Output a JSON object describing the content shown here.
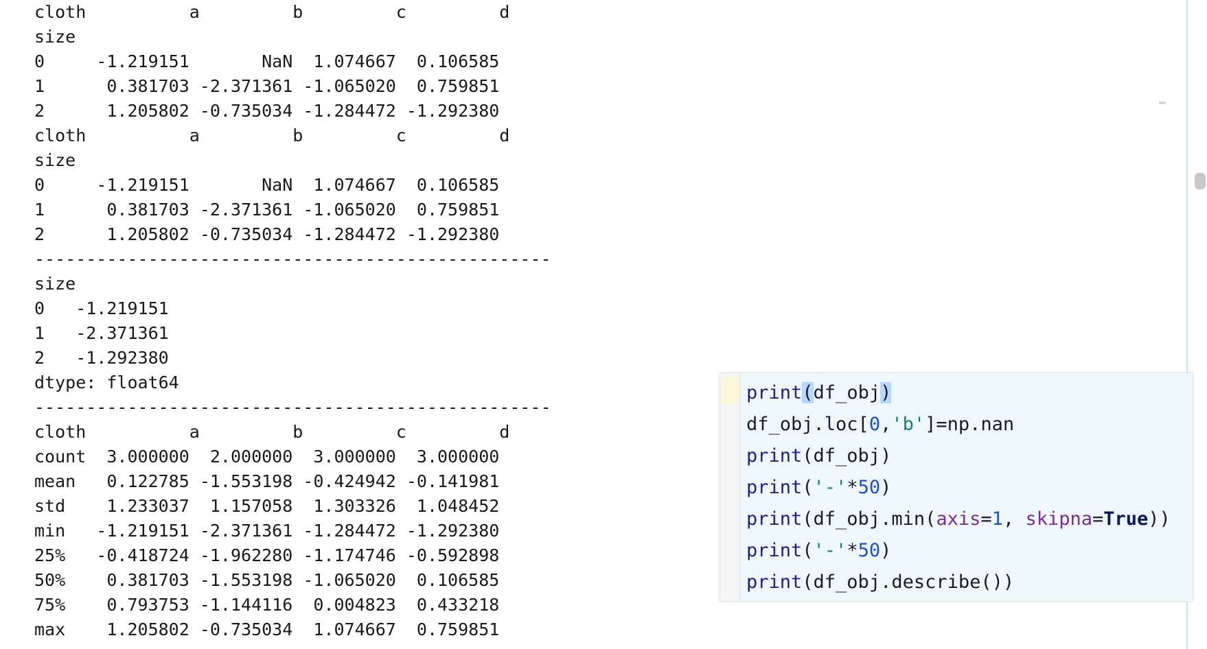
{
  "console": {
    "output_text": "cloth          a         b         c         d\nsize\n0     -1.219151       NaN  1.074667  0.106585\n1      0.381703 -2.371361 -1.065020  0.759851\n2      1.205802 -0.735034 -1.284472 -1.292380\ncloth          a         b         c         d\nsize\n0     -1.219151       NaN  1.074667  0.106585\n1      0.381703 -2.371361 -1.065020  0.759851\n2      1.205802 -0.735034 -1.284472 -1.292380\n--------------------------------------------------\nsize\n0   -1.219151\n1   -2.371361\n2   -1.292380\ndtype: float64\n--------------------------------------------------\ncloth          a         b         c         d\ncount  3.000000  2.000000  3.000000  3.000000\nmean   0.122785 -1.553198 -0.424942 -0.141981\nstd    1.233037  1.157058  1.303326  1.048452\nmin   -1.219151 -2.371361 -1.284472 -1.292380\n25%   -0.418724 -1.962280 -1.174746 -0.592898\n50%    0.381703 -1.553198 -1.065020  0.106585\n75%    0.793753 -1.144116  0.004823  0.433218\nmax    1.205802 -0.735034  1.074667  0.759851"
  },
  "code_panel": {
    "lines": [
      {
        "parts": [
          {
            "t": "print",
            "c": "kw"
          },
          {
            "t": "(",
            "c": "brace-hl"
          },
          {
            "t": "df_obj",
            "c": ""
          },
          {
            "t": ")",
            "c": "brace-hl"
          }
        ]
      },
      {
        "parts": [
          {
            "t": "df_obj.loc[",
            "c": ""
          },
          {
            "t": "0",
            "c": "num"
          },
          {
            "t": ",",
            "c": ""
          },
          {
            "t": "'b'",
            "c": "str"
          },
          {
            "t": "]=np.nan",
            "c": ""
          }
        ]
      },
      {
        "parts": [
          {
            "t": "print",
            "c": "kw"
          },
          {
            "t": "(df_obj)",
            "c": ""
          }
        ]
      },
      {
        "parts": [
          {
            "t": "print",
            "c": "kw"
          },
          {
            "t": "(",
            "c": ""
          },
          {
            "t": "'-'",
            "c": "str"
          },
          {
            "t": "*",
            "c": ""
          },
          {
            "t": "50",
            "c": "num"
          },
          {
            "t": ")",
            "c": ""
          }
        ]
      },
      {
        "parts": [
          {
            "t": "print",
            "c": "kw"
          },
          {
            "t": "(df_obj.min(",
            "c": ""
          },
          {
            "t": "axis",
            "c": "param"
          },
          {
            "t": "=",
            "c": ""
          },
          {
            "t": "1",
            "c": "num"
          },
          {
            "t": ", ",
            "c": ""
          },
          {
            "t": "skipna",
            "c": "param"
          },
          {
            "t": "=",
            "c": ""
          },
          {
            "t": "True",
            "c": "bool"
          },
          {
            "t": "))",
            "c": ""
          }
        ]
      },
      {
        "parts": [
          {
            "t": "print",
            "c": "kw"
          },
          {
            "t": "(",
            "c": ""
          },
          {
            "t": "'-'",
            "c": "str"
          },
          {
            "t": "*",
            "c": ""
          },
          {
            "t": "50",
            "c": "num"
          },
          {
            "t": ")",
            "c": ""
          }
        ]
      },
      {
        "parts": [
          {
            "t": "print",
            "c": "kw"
          },
          {
            "t": "(df_obj.describe())",
            "c": ""
          }
        ]
      }
    ]
  }
}
